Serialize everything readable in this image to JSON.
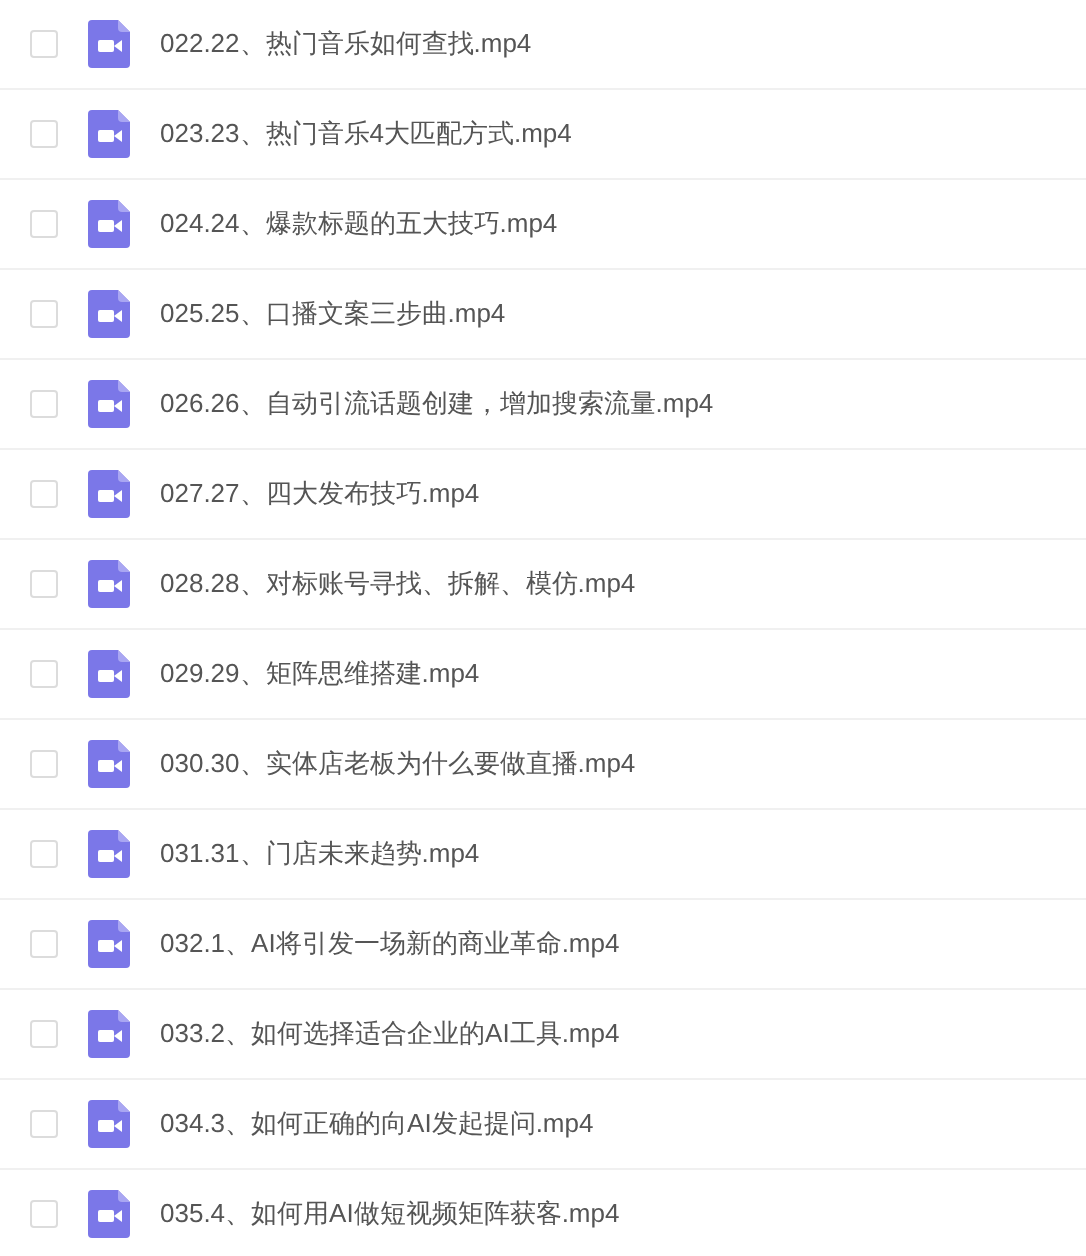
{
  "files": [
    {
      "name": "022.22、热门音乐如何查找.mp4",
      "checked": false
    },
    {
      "name": "023.23、热门音乐4大匹配方式.mp4",
      "checked": false
    },
    {
      "name": "024.24、爆款标题的五大技巧.mp4",
      "checked": false
    },
    {
      "name": "025.25、口播文案三步曲.mp4",
      "checked": false
    },
    {
      "name": "026.26、自动引流话题创建，增加搜索流量.mp4",
      "checked": false
    },
    {
      "name": "027.27、四大发布技巧.mp4",
      "checked": false
    },
    {
      "name": "028.28、对标账号寻找、拆解、模仿.mp4",
      "checked": false
    },
    {
      "name": "029.29、矩阵思维搭建.mp4",
      "checked": false
    },
    {
      "name": "030.30、实体店老板为什么要做直播.mp4",
      "checked": false
    },
    {
      "name": "031.31、门店未来趋势.mp4",
      "checked": false
    },
    {
      "name": "032.1、AI将引发一场新的商业革命.mp4",
      "checked": false
    },
    {
      "name": "033.2、如何选择适合企业的AI工具.mp4",
      "checked": false
    },
    {
      "name": "034.3、如何正确的向AI发起提问.mp4",
      "checked": false
    },
    {
      "name": "035.4、如何用AI做短视频矩阵获客.mp4",
      "checked": false
    }
  ]
}
